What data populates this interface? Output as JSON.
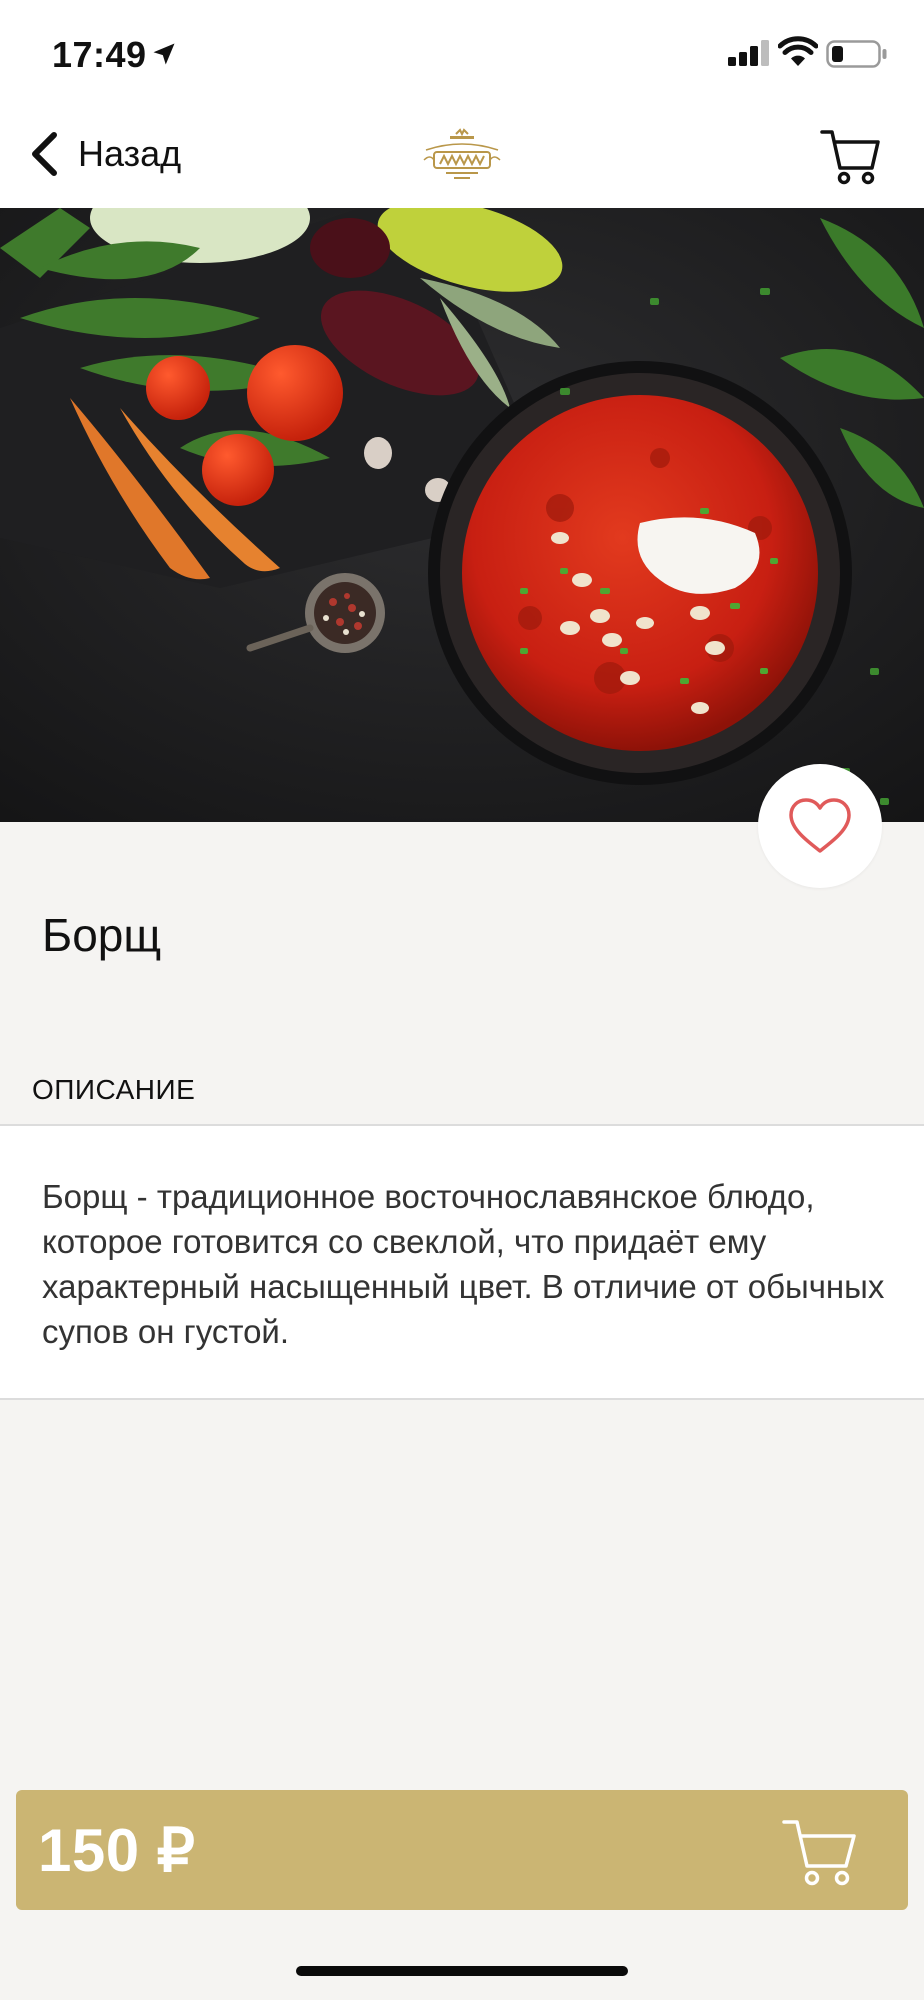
{
  "status_bar": {
    "time": "17:49"
  },
  "nav": {
    "back_label": "Назад"
  },
  "dish": {
    "title": "Борщ",
    "description_label": "ОПИСАНИЕ",
    "description": "Борщ - традиционное восточнославянское блюдо, которое готовится со свеклой, что придаёт ему характерный насыщенный цвет. В отличие от обычных супов он густой."
  },
  "purchase": {
    "price": "150 ₽"
  },
  "colors": {
    "accent_gold": "#cbb573",
    "favorite_red": "#e05a5a",
    "background": "#f5f4f2"
  },
  "icons": {
    "back": "chevron-left-icon",
    "cart": "cart-icon",
    "favorite": "heart-outline-icon",
    "location": "location-arrow-icon",
    "signal": "cellular-signal-icon",
    "wifi": "wifi-icon",
    "battery": "battery-icon"
  }
}
